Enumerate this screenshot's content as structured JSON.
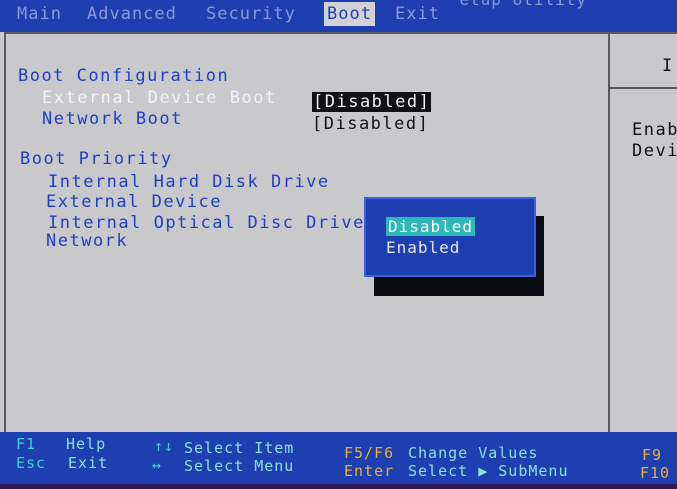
{
  "menu": {
    "title_fragment": "etup Utility",
    "tabs": [
      "Main",
      "Advanced",
      "Security",
      "Boot",
      "Exit"
    ],
    "active_tab": "Boot"
  },
  "boot_configuration": {
    "heading": "Boot Configuration",
    "items": [
      {
        "label": "External Device Boot",
        "value": "[Disabled]",
        "selected": true
      },
      {
        "label": "Network Boot",
        "value": "[Disabled]",
        "selected": false
      }
    ]
  },
  "boot_priority": {
    "heading": "Boot Priority",
    "items": [
      "Internal Hard Disk Drive",
      "External Device",
      "Internal Optical Disc Drive",
      "Network"
    ]
  },
  "help_panel": {
    "top": "I",
    "lines": [
      "Enab",
      "Devi"
    ]
  },
  "popup": {
    "options": [
      "Disabled",
      "Enabled"
    ],
    "selected": "Disabled"
  },
  "keys": {
    "f1": {
      "key": "F1",
      "label": "Help"
    },
    "esc": {
      "key": "Esc",
      "label": "Exit"
    },
    "updown": {
      "key": "↑↓",
      "label": "Select Item"
    },
    "leftright": {
      "key": "↔",
      "label": "Select Menu"
    },
    "f5f6": {
      "key": "F5/F6",
      "label": "Change Values"
    },
    "enter": {
      "key": "Enter",
      "label": "Select ▶ SubMenu"
    },
    "f9": {
      "key": "F9"
    },
    "f10": {
      "key": "F10"
    }
  }
}
